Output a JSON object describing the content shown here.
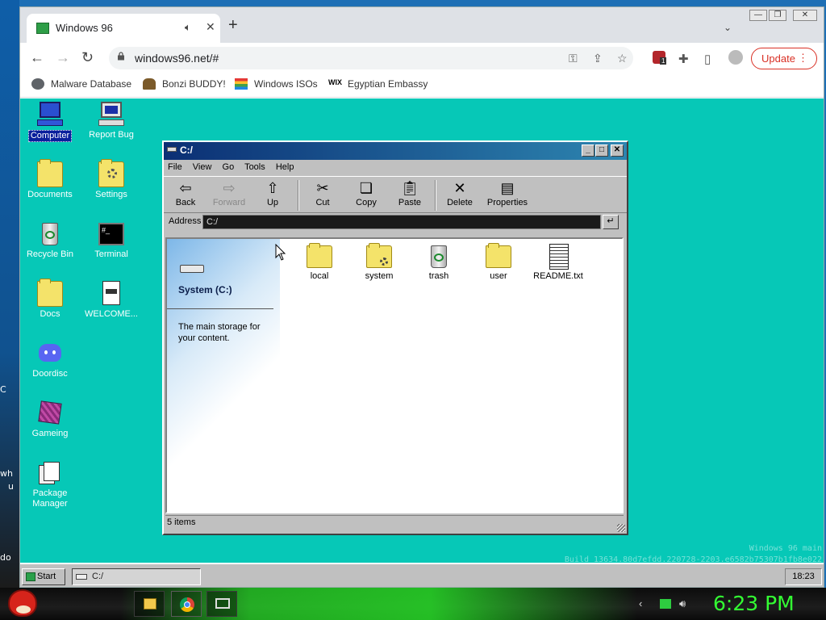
{
  "browser": {
    "tab_title": "Windows 96",
    "url": "windows96.net/#",
    "update_label": "Update",
    "bookmarks": [
      {
        "label": "Malware Database",
        "icon": "globe-icon"
      },
      {
        "label": "Bonzi BUDDY!",
        "icon": "gorilla-icon"
      },
      {
        "label": "Windows ISOs",
        "icon": "windows-flag-icon"
      },
      {
        "label": "Egyptian Embassy",
        "icon": "wix-icon"
      }
    ],
    "extension_badge": "1"
  },
  "desktop": {
    "icons": [
      {
        "label": "Computer",
        "icon": "computer-icon",
        "selected": true
      },
      {
        "label": "Report Bug",
        "icon": "report-bug-icon"
      },
      {
        "label": "Documents",
        "icon": "documents-folder-icon"
      },
      {
        "label": "Settings",
        "icon": "settings-folder-icon"
      },
      {
        "label": "Recycle Bin",
        "icon": "recycle-bin-icon"
      },
      {
        "label": "Terminal",
        "icon": "terminal-icon"
      },
      {
        "label": "Docs",
        "icon": "folder-icon"
      },
      {
        "label": "WELCOME...",
        "icon": "text-file-icon"
      },
      {
        "label": "Doordisc",
        "icon": "discord-icon"
      },
      {
        "label": "Gameing",
        "icon": "game-cube-icon"
      },
      {
        "label": "Package Manager",
        "icon": "package-manager-icon"
      }
    ],
    "watermark_line1": "Windows 96 main",
    "watermark_line2": "Build 13634.80d7efdd.220728-2203.e6582b75307b1fb8e022"
  },
  "explorer": {
    "title": "C:/",
    "menu": [
      "File",
      "View",
      "Go",
      "Tools",
      "Help"
    ],
    "toolbar": {
      "back": "Back",
      "forward": "Forward",
      "up": "Up",
      "cut": "Cut",
      "copy": "Copy",
      "paste": "Paste",
      "delete": "Delete",
      "properties": "Properties"
    },
    "address_label": "Address",
    "address_value": "C:/",
    "drive_name": "System (C:)",
    "drive_description": "The main storage for your content.",
    "files": [
      {
        "label": "local",
        "icon": "folder-icon"
      },
      {
        "label": "system",
        "icon": "system-folder-icon"
      },
      {
        "label": "trash",
        "icon": "recycle-bin-icon"
      },
      {
        "label": "user",
        "icon": "folder-icon"
      },
      {
        "label": "README.txt",
        "icon": "text-file-icon"
      }
    ],
    "status": "5 items"
  },
  "w96_taskbar": {
    "start_label": "Start",
    "task_label": "C:/",
    "clock": "18:23"
  },
  "host": {
    "clock": "6:23 PM",
    "left_clip": [
      "C",
      "wh",
      "u",
      "do"
    ]
  }
}
